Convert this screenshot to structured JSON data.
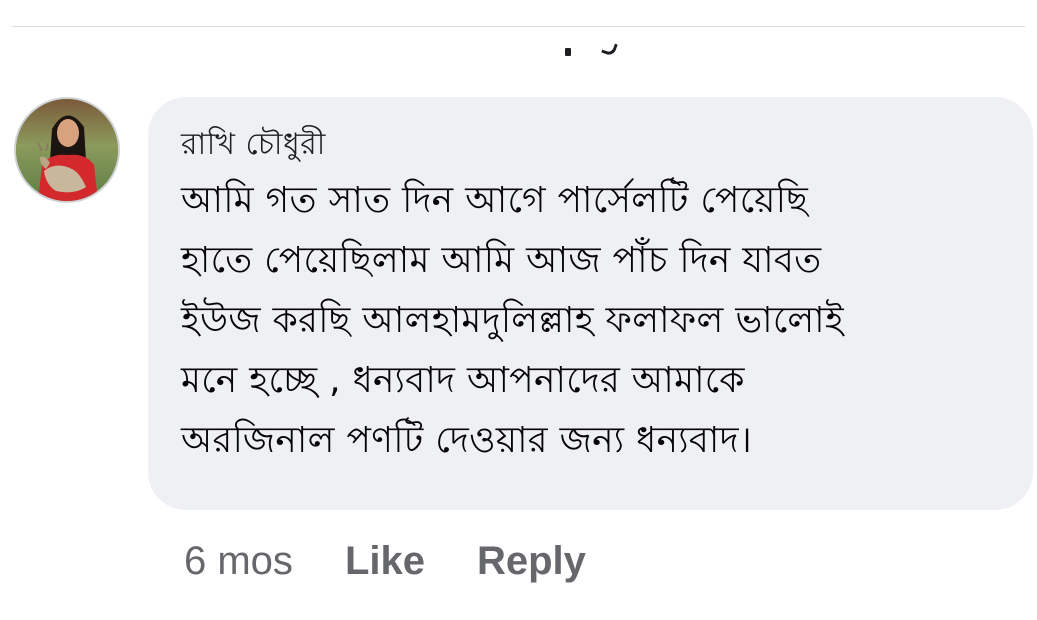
{
  "comment": {
    "author": "রাখি চৌধুরী",
    "text": "আমি গত সাত দিন আগে পার্সেলটি পেয়েছি\nহাতে পেয়েছিলাম আমি আজ পাঁচ দিন যাবত\nইউজ করছি আলহামদুলিল্লাহ ফলাফল ভালোই\nমনে হচ্ছে , ধন্যবাদ আপনাদের আমাকে\nঅরজিনাল পণটি দেওয়ার জন্য ধন্যবাদ।",
    "avatar_icon": "user-photo-avatar"
  },
  "actions": {
    "timestamp": "6 mos",
    "like_label": "Like",
    "reply_label": "Reply"
  },
  "colors": {
    "bubble_bg": "#eff0f3",
    "text": "#050505",
    "meta_text": "#65676b"
  }
}
